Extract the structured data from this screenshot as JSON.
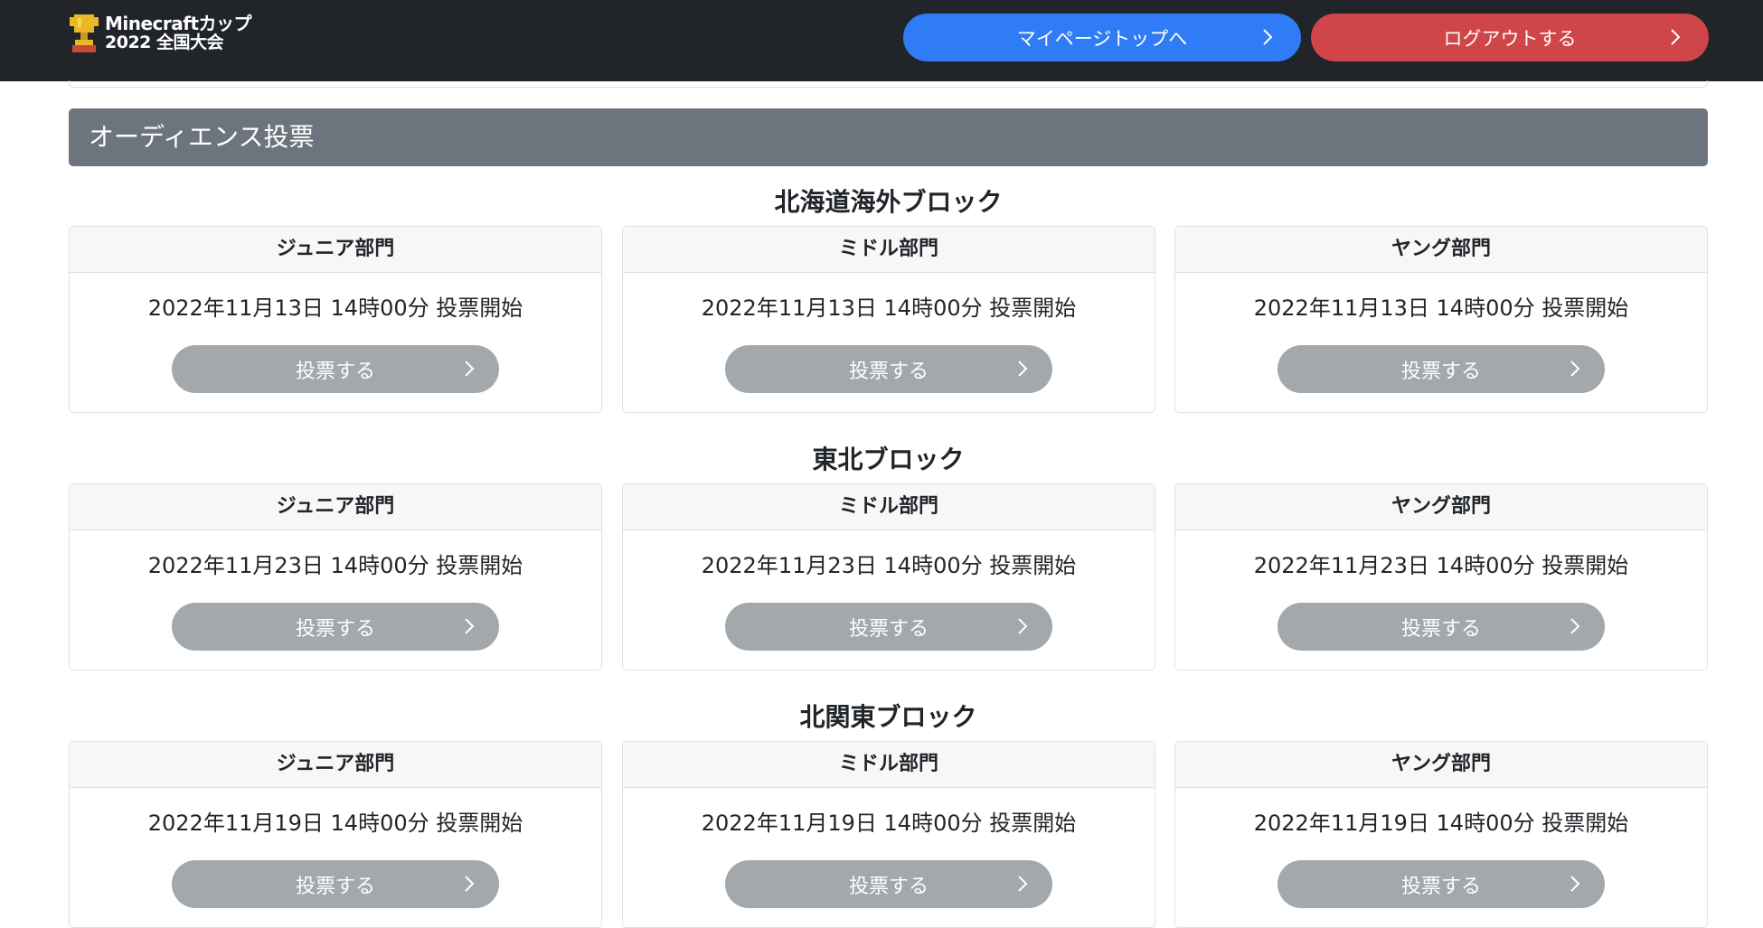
{
  "header": {
    "logo_line1": "Minecraftカップ",
    "logo_line2": "2022 全国大会",
    "mypage_label": "マイページトップへ",
    "logout_label": "ログアウトする",
    "mypage_color": "#2f7cf6",
    "logout_color": "#cf4548"
  },
  "section": {
    "title": "オーディエンス投票"
  },
  "blocks": [
    {
      "title": "北海道海外ブロック",
      "cards": [
        {
          "division": "ジュニア部門",
          "date": "2022年11月13日 14時00分 投票開始",
          "button": "投票する"
        },
        {
          "division": "ミドル部門",
          "date": "2022年11月13日 14時00分 投票開始",
          "button": "投票する"
        },
        {
          "division": "ヤング部門",
          "date": "2022年11月13日 14時00分 投票開始",
          "button": "投票する"
        }
      ]
    },
    {
      "title": "東北ブロック",
      "cards": [
        {
          "division": "ジュニア部門",
          "date": "2022年11月23日 14時00分 投票開始",
          "button": "投票する"
        },
        {
          "division": "ミドル部門",
          "date": "2022年11月23日 14時00分 投票開始",
          "button": "投票する"
        },
        {
          "division": "ヤング部門",
          "date": "2022年11月23日 14時00分 投票開始",
          "button": "投票する"
        }
      ]
    },
    {
      "title": "北関東ブロック",
      "cards": [
        {
          "division": "ジュニア部門",
          "date": "2022年11月19日 14時00分 投票開始",
          "button": "投票する"
        },
        {
          "division": "ミドル部門",
          "date": "2022年11月19日 14時00分 投票開始",
          "button": "投票する"
        },
        {
          "division": "ヤング部門",
          "date": "2022年11月19日 14時00分 投票開始",
          "button": "投票する"
        }
      ]
    }
  ]
}
